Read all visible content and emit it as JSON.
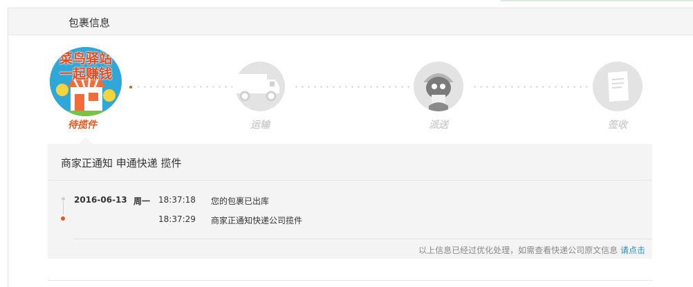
{
  "header": {
    "title": "包裹信息"
  },
  "badge": {
    "line1": "菜鸟驿站",
    "line2": "一起赚钱"
  },
  "steps": [
    {
      "label": "待揽件",
      "icon": "cainiao-station-icon",
      "active": true
    },
    {
      "label": "运输",
      "icon": "delivery-truck-icon",
      "active": false
    },
    {
      "label": "派送",
      "icon": "courier-icon",
      "active": false
    },
    {
      "label": "签收",
      "icon": "signed-document-icon",
      "active": false
    }
  ],
  "detail": {
    "title": "商家正通知 申通快递 揽件",
    "entries": [
      {
        "date": "2016-06-13",
        "weekday": "周一",
        "time": "18:37:18",
        "message": "您的包裹已出库"
      },
      {
        "date": "",
        "weekday": "",
        "time": "18:37:29",
        "message": "商家正通知快递公司揽件"
      }
    ],
    "note": "以上信息已经过优化处理，如需查看快递公司原文信息",
    "note_link": "请点击"
  },
  "colors": {
    "accent": "#e8571b",
    "link": "#2a8fbd",
    "inactive": "#d0d0d0"
  }
}
